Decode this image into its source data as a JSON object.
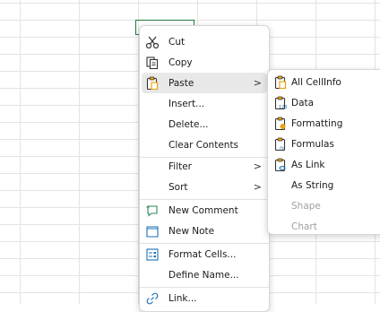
{
  "context_menu": {
    "items": [
      {
        "label": "Cut",
        "icon": "scissors-icon"
      },
      {
        "label": "Copy",
        "icon": "copy-icon"
      },
      {
        "label": "Paste",
        "icon": "clipboard-icon",
        "submenu": true
      },
      {
        "label": "Insert...",
        "icon": ""
      },
      {
        "label": "Delete...",
        "icon": ""
      },
      {
        "label": "Clear Contents",
        "icon": ""
      },
      {
        "label": "Filter",
        "icon": "",
        "submenu": true
      },
      {
        "label": "Sort",
        "icon": "",
        "submenu": true
      },
      {
        "label": "New Comment",
        "icon": "comment-icon"
      },
      {
        "label": "New Note",
        "icon": "note-icon"
      },
      {
        "label": "Format Cells...",
        "icon": "format-cells-icon"
      },
      {
        "label": "Define Name...",
        "icon": ""
      },
      {
        "label": "Link...",
        "icon": "link-icon"
      }
    ],
    "chevron": ">"
  },
  "paste_submenu": {
    "items": [
      {
        "label": "All CellInfo",
        "icon": "paste-all-icon",
        "enabled": true
      },
      {
        "label": "Data",
        "icon": "paste-data-icon",
        "enabled": true
      },
      {
        "label": "Formatting",
        "icon": "paste-formatting-icon",
        "enabled": true
      },
      {
        "label": "Formulas",
        "icon": "paste-formulas-icon",
        "enabled": true
      },
      {
        "label": "As Link",
        "icon": "paste-link-icon",
        "enabled": true
      },
      {
        "label": "As String",
        "icon": "",
        "enabled": true
      },
      {
        "label": "Shape",
        "icon": "",
        "enabled": false
      },
      {
        "label": "Chart",
        "icon": "",
        "enabled": false
      }
    ]
  },
  "colors": {
    "selection_border": "#1f7a3a",
    "clipboard_accent": "#e8a317",
    "hover_bg": "#e8e8e8"
  }
}
